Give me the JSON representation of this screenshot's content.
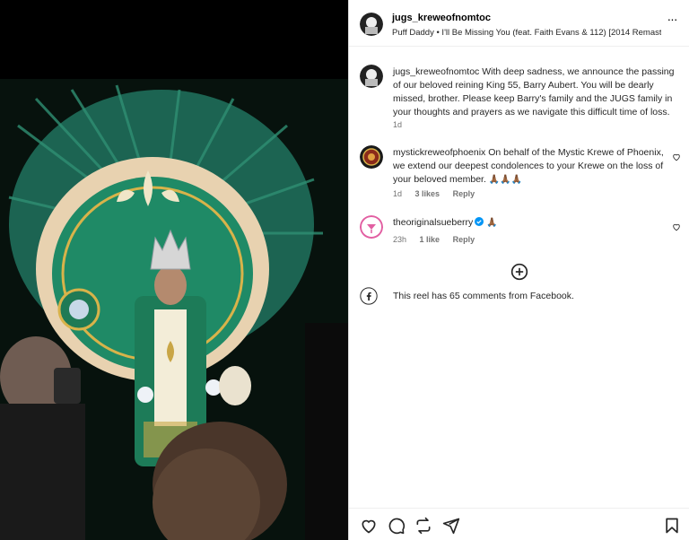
{
  "post": {
    "username": "jugs_kreweofnomtoc",
    "audio": "Puff Daddy • I'll Be Missing You (feat. Faith Evans & 112) [2014 Remaster"
  },
  "caption": {
    "username": "jugs_kreweofnomtoc",
    "text": "With deep sadness, we announce the passing of our beloved reining King 55, Barry Aubert. You will be dearly missed, brother. Please keep Barry's family and the JUGS family in your thoughts and prayers as we navigate this difficult time of loss.",
    "time": "1d"
  },
  "comments": [
    {
      "username": "mystickreweofphoenix",
      "text": "On behalf of the Mystic Krewe of Phoenix, we extend our deepest condolences to your Krewe on the loss of your beloved member.",
      "emoji": "🙏🏾🙏🏾🙏🏾",
      "time": "1d",
      "likes": "3 likes",
      "reply": "Reply"
    },
    {
      "username": "theoriginalsueberry",
      "text": "",
      "emoji": "🙏🏾",
      "time": "23h",
      "likes": "1 like",
      "reply": "Reply"
    }
  ],
  "facebook_note": "This reel has 65 comments from Facebook.",
  "icons": {
    "more": "more-options-icon",
    "like": "heart-icon",
    "comment": "comment-icon",
    "share_reel": "repost-icon",
    "send": "send-icon",
    "save": "bookmark-icon",
    "load_more": "plus-circle-icon",
    "facebook": "facebook-icon",
    "verified": "verified-badge-icon"
  },
  "colors": {
    "verified": "#0095f6",
    "secondary_text": "#737373",
    "mardi_gras_green": "#1f7a55",
    "gold": "#d8b34a"
  }
}
